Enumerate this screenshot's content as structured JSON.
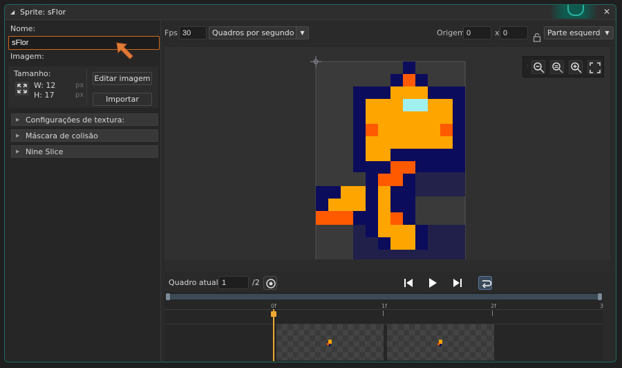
{
  "window": {
    "title": "Sprite: sFlor"
  },
  "left": {
    "name_label": "Nome:",
    "name_value": "sFlor",
    "image_label": "Imagem:",
    "size_label": "Tamanho:",
    "width": "W: 12",
    "height": "H: 17",
    "unit": "px",
    "edit_button": "Editar imagem",
    "import_button": "Importar",
    "sections": [
      "Configurações de textura:",
      "Máscara de colisão",
      "Nine Slice"
    ]
  },
  "toolbar": {
    "fps_label": "Fps",
    "fps_value": "30",
    "fps_mode": "Quadros por segundo",
    "origin_label": "Origem",
    "origin_x": "0",
    "x_sep": "x",
    "origin_y": "0",
    "origin_mode": "Parte esquerda s"
  },
  "playback": {
    "frame_label": "Quadro atual:",
    "frame_value": "1",
    "frame_total": "/2"
  },
  "timeline": {
    "ticks": [
      "0f",
      "1f",
      "2f",
      "3"
    ]
  },
  "colors": {
    "accent": "#d2691e",
    "navy": "#0c0c5c",
    "orange": "#ffa500",
    "red_orange": "#ff5a00",
    "light_cyan": "#a0f0f0"
  }
}
